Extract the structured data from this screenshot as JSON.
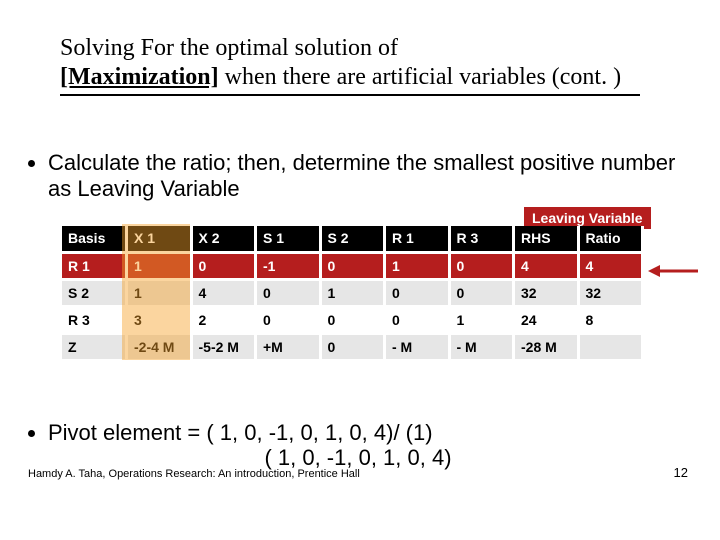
{
  "title": {
    "line1": "Solving For the optimal solution of",
    "maxword": "[Maximization]",
    "line2_rest": " when there are artificial variables (cont. )"
  },
  "bullet1": "Calculate the ratio; then, determine the smallest positive number as Leaving Variable",
  "leaving_label": "Leaving Variable",
  "table": {
    "headers": [
      "Basis",
      "X 1",
      "X 2",
      "S 1",
      "S 2",
      "R 1",
      "R 3",
      "RHS",
      "Ratio"
    ],
    "rows": [
      {
        "style": "red",
        "cells": [
          "R 1",
          "1",
          "0",
          "-1",
          "0",
          "1",
          "0",
          "4",
          "4"
        ]
      },
      {
        "style": "grey",
        "cells": [
          "S 2",
          "1",
          "4",
          "0",
          "1",
          "0",
          "0",
          "32",
          "32"
        ]
      },
      {
        "style": "white",
        "cells": [
          "R 3",
          "3",
          "2",
          "0",
          "0",
          "0",
          "1",
          "24",
          "8"
        ]
      },
      {
        "style": "grey",
        "cells": [
          "Z",
          "-2-4 M",
          "-5-2 M",
          "+M",
          "0",
          "- M",
          "- M",
          "-28 M",
          ""
        ]
      }
    ]
  },
  "bullet2_line1": "Pivot element = ( 1, 0, -1, 0, 1, 0, 4)/ (1)",
  "bullet2_line2": "( 1, 0, -1, 0, 1, 0, 4)",
  "footer": "Hamdy A. Taha, Operations Research: An introduction, Prentice Hall",
  "page": "12"
}
